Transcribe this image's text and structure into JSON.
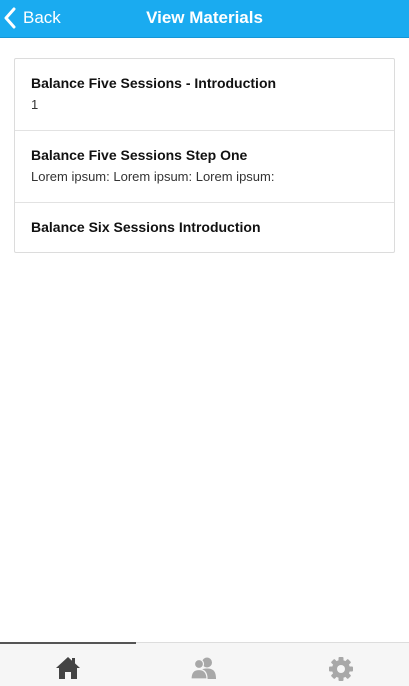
{
  "header": {
    "back_label": "Back",
    "title": "View Materials",
    "accent_color": "#1aabf0"
  },
  "materials": [
    {
      "title": "Balance Five Sessions - Introduction",
      "subtitle": "1"
    },
    {
      "title": "Balance Five Sessions Step One",
      "subtitle": "Lorem ipsum: Lorem ipsum: Lorem ipsum:"
    },
    {
      "title": "Balance Six Sessions Introduction",
      "subtitle": ""
    }
  ],
  "tabs": [
    {
      "icon": "home-icon",
      "active": true
    },
    {
      "icon": "users-icon",
      "active": false
    },
    {
      "icon": "gear-icon",
      "active": false
    }
  ]
}
